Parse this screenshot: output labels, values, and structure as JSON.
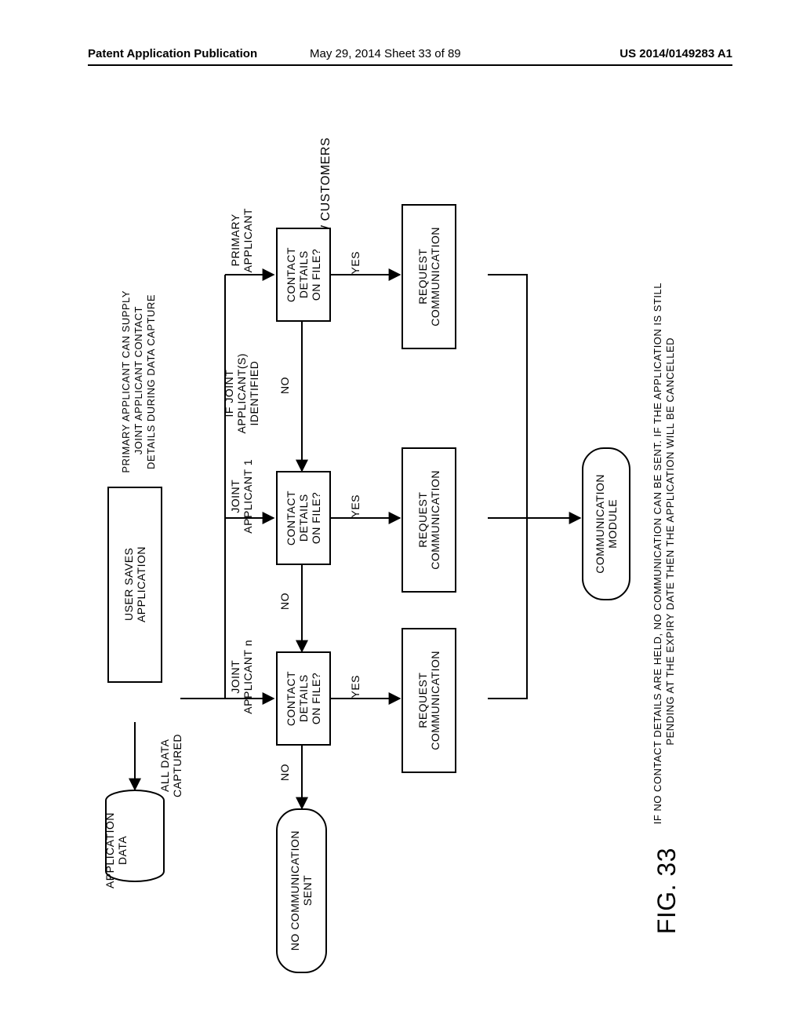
{
  "header": {
    "left": "Patent Application Publication",
    "mid": "May 29, 2014  Sheet 33 of 89",
    "right": "US 2014/0149283 A1"
  },
  "labels": {
    "title": "NEW CUSTOMERS",
    "primary_applicant": "PRIMARY\nAPPLICANT",
    "if_joint": "IF JOINT\nAPPLICANT(S)\nIDENTIFIED",
    "joint1": "JOINT\nAPPLICANT 1",
    "jointn": "JOINT\nAPPLICANT n",
    "yes": "YES",
    "no": "NO",
    "note1_line1": "PRIMARY APPLICANT CAN SUPPLY",
    "note1_line2": "JOINT APPLICANT CONTACT",
    "note1_line3": "DETAILS DURING DATA CAPTURE",
    "all_data": "ALL DATA\nCAPTURED",
    "app_data": "APPLICATION\nDATA",
    "user_saves": "USER SAVES\nAPPLICATION",
    "contact_q": "CONTACT\nDETAILS\nON FILE?",
    "request_comm": "REQUEST\nCOMMUNICATION",
    "no_comm": "NO COMMUNICATION\nSENT",
    "comm_module": "COMMUNICATION\nMODULE",
    "footer_line1": "IF NO CONTACT DETAILS ARE HELD, NO COMMUNICATION CAN BE SENT. IF THE APPLICATION IS STILL",
    "footer_line2": "PENDING AT THE EXPIRY DATE THEN THE APPLICATION WILL BE CANCELLED",
    "fig": "FIG. 33"
  }
}
